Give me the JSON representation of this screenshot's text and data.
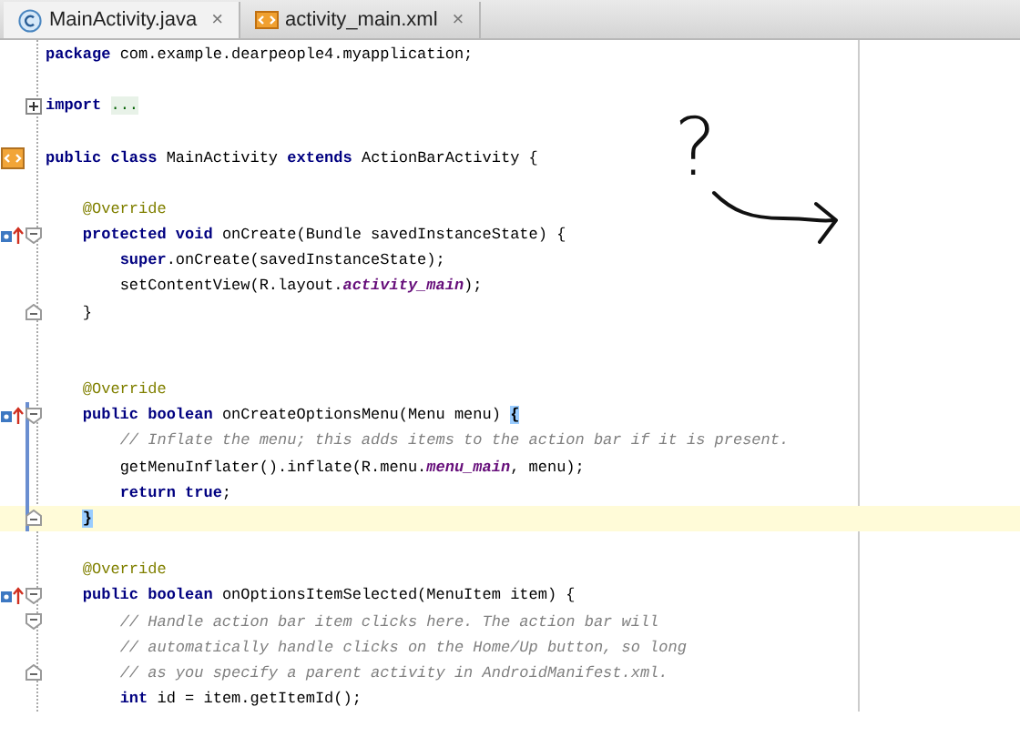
{
  "tabs": [
    {
      "label": "MainActivity.java",
      "kind": "class",
      "close": "×",
      "selected": true
    },
    {
      "label": "activity_main.xml",
      "kind": "xml",
      "close": "×",
      "selected": false
    }
  ],
  "editor": {
    "lines": [
      {
        "kind": "code",
        "tokens": [
          {
            "text": "package",
            "kind": "keyword"
          },
          {
            "text": " com.example.dearpeople4.myapplication;",
            "kind": "plain"
          }
        ]
      },
      {
        "kind": "blank"
      },
      {
        "kind": "code",
        "fold_collapsed": true,
        "tokens": [
          {
            "text": "import",
            "kind": "keyword"
          },
          {
            "text": " ...",
            "kind": "folded"
          }
        ]
      },
      {
        "kind": "blank"
      },
      {
        "kind": "code",
        "layout_marker": true,
        "tokens": [
          {
            "text": "public class",
            "kind": "keyword"
          },
          {
            "text": " MainActivity ",
            "kind": "plain"
          },
          {
            "text": "extends",
            "kind": "keyword"
          },
          {
            "text": " ActionBarActivity {",
            "kind": "plain"
          }
        ]
      },
      {
        "kind": "blank"
      },
      {
        "kind": "code",
        "tokens": [
          {
            "text": "    @Override",
            "kind": "annotation"
          }
        ]
      },
      {
        "kind": "code",
        "overrides": true,
        "fold_start": true,
        "tokens": [
          {
            "text": "    protected void",
            "kind": "keyword"
          },
          {
            "text": " onCreate(Bundle savedInstanceState) {",
            "kind": "plain"
          }
        ]
      },
      {
        "kind": "code",
        "tokens": [
          {
            "text": "        super",
            "kind": "keyword"
          },
          {
            "text": ".onCreate(savedInstanceState);",
            "kind": "plain"
          }
        ]
      },
      {
        "kind": "code",
        "tokens": [
          {
            "text": "        setContentView(R.layout.",
            "kind": "plain"
          },
          {
            "text": "activity_main",
            "kind": "field"
          },
          {
            "text": ");",
            "kind": "plain"
          }
        ]
      },
      {
        "kind": "code",
        "fold_end": true,
        "tokens": [
          {
            "text": "    }",
            "kind": "plain"
          }
        ]
      },
      {
        "kind": "blank"
      },
      {
        "kind": "blank"
      },
      {
        "kind": "code",
        "tokens": [
          {
            "text": "    @Override",
            "kind": "annotation"
          }
        ]
      },
      {
        "kind": "code",
        "overrides": true,
        "fold_start": true,
        "changed": true,
        "tokens": [
          {
            "text": "    public boolean",
            "kind": "keyword"
          },
          {
            "text": " onCreateOptionsMenu(Menu menu) ",
            "kind": "plain"
          },
          {
            "text": "{",
            "kind": "brace-match"
          }
        ]
      },
      {
        "kind": "code",
        "changed": true,
        "tokens": [
          {
            "text": "        // Inflate the menu; this adds items to the action bar if it is present.",
            "kind": "comment"
          }
        ]
      },
      {
        "kind": "code",
        "changed": true,
        "tokens": [
          {
            "text": "        getMenuInflater().inflate(R.menu.",
            "kind": "plain"
          },
          {
            "text": "menu_main",
            "kind": "field"
          },
          {
            "text": ", menu);",
            "kind": "plain"
          }
        ]
      },
      {
        "kind": "code",
        "changed": true,
        "tokens": [
          {
            "text": "        return true",
            "kind": "keyword"
          },
          {
            "text": ";",
            "kind": "plain"
          }
        ]
      },
      {
        "kind": "code",
        "fold_end": true,
        "changed": true,
        "current": true,
        "tokens": [
          {
            "text": "    }",
            "kind": "brace-match"
          }
        ]
      },
      {
        "kind": "blank"
      },
      {
        "kind": "code",
        "tokens": [
          {
            "text": "    @Override",
            "kind": "annotation"
          }
        ]
      },
      {
        "kind": "code",
        "overrides": true,
        "fold_start": true,
        "tokens": [
          {
            "text": "    public boolean",
            "kind": "keyword"
          },
          {
            "text": " onOptionsItemSelected(MenuItem item) {",
            "kind": "plain"
          }
        ]
      },
      {
        "kind": "code",
        "fold_start": true,
        "tokens": [
          {
            "text": "        // Handle action bar item clicks here. The action bar will",
            "kind": "comment"
          }
        ]
      },
      {
        "kind": "code",
        "tokens": [
          {
            "text": "        // automatically handle clicks on the Home/Up button, so long",
            "kind": "comment"
          }
        ]
      },
      {
        "kind": "code",
        "fold_end": true,
        "tokens": [
          {
            "text": "        // as you specify a parent activity in AndroidManifest.xml.",
            "kind": "comment"
          }
        ]
      },
      {
        "kind": "code",
        "tokens": [
          {
            "text": "        int",
            "kind": "keyword"
          },
          {
            "text": " id = item.getItemId();",
            "kind": "plain"
          }
        ]
      }
    ]
  },
  "annotation": {
    "text": "?"
  }
}
